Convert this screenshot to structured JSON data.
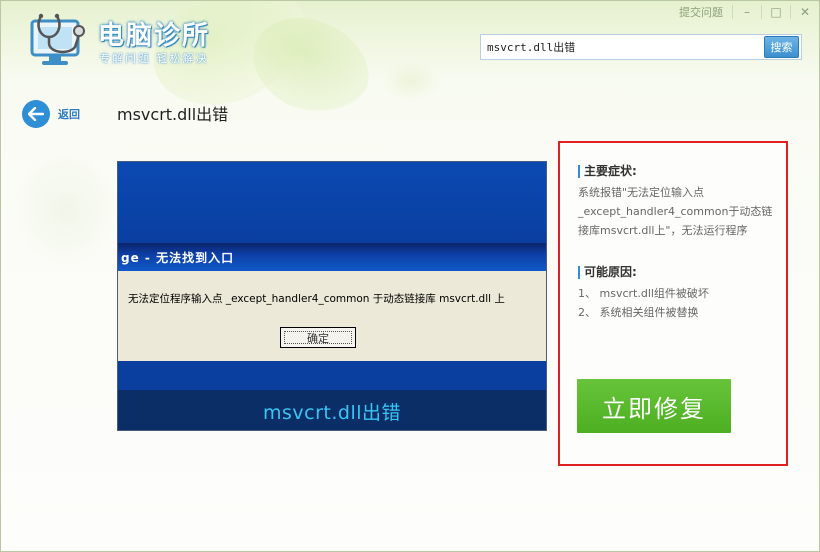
{
  "app": {
    "title": "电脑诊所",
    "slogan": "专解问题 轻松解决"
  },
  "window_controls": {
    "feedback_label": "提交问题",
    "minimize": "–",
    "maximize": "□",
    "close": "✕"
  },
  "search": {
    "value": "msvcrt.dll出错",
    "button_label": "搜索"
  },
  "nav": {
    "back_label": "返回",
    "page_title": "msvcrt.dll出错"
  },
  "screenshot": {
    "dialog_title": "ge - 无法找到入口",
    "dialog_message": "无法定位程序输入点 _except_handler4_common 于动态链接库 msvcrt.dll 上",
    "ok_label": "确定",
    "caption": "msvcrt.dll出错"
  },
  "info": {
    "symptom_title": "主要症状:",
    "symptom_text": "系统报错\"无法定位输入点_except_handler4_common于动态链接库msvcrt.dll上\"，无法运行程序",
    "cause_title": "可能原因:",
    "causes": [
      "1、 msvcrt.dll组件被破坏",
      "2、 系统相关组件被替换"
    ],
    "fix_button_label": "立即修复"
  },
  "colors": {
    "accent_blue": "#2e8fd6",
    "fix_green": "#55b52a",
    "highlight_red": "#e02020",
    "caption_cyan": "#39c6f5"
  }
}
